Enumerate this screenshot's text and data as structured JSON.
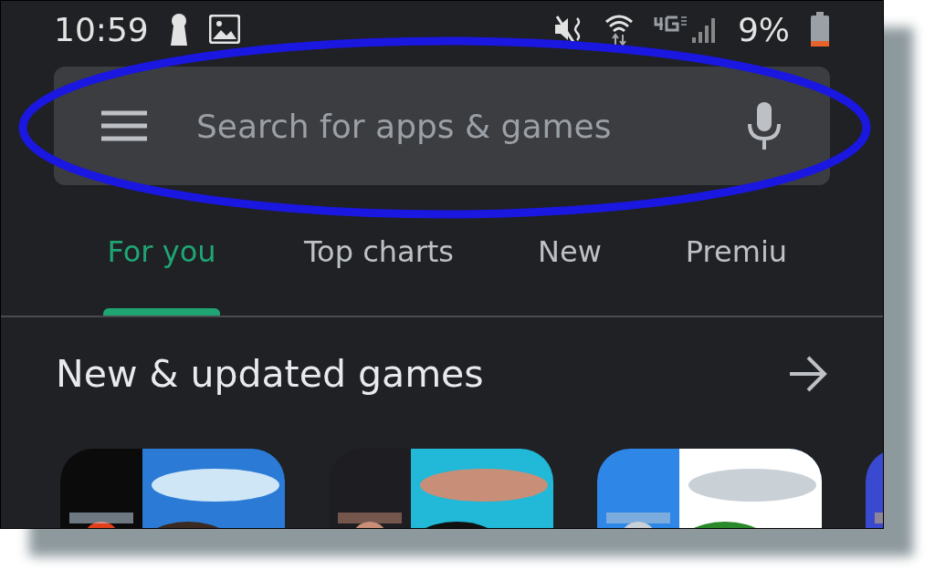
{
  "status_bar": {
    "time": "10:59",
    "battery": "9%"
  },
  "search": {
    "placeholder": "Search for apps & games"
  },
  "tabs": [
    {
      "label": "For you",
      "selected": true
    },
    {
      "label": "Top charts",
      "selected": false
    },
    {
      "label": "New",
      "selected": false
    },
    {
      "label": "Premiu",
      "selected": false
    }
  ],
  "section": {
    "title": "New & updated games"
  },
  "annotation": {
    "kind": "ellipse",
    "color": "#1a17e0"
  }
}
